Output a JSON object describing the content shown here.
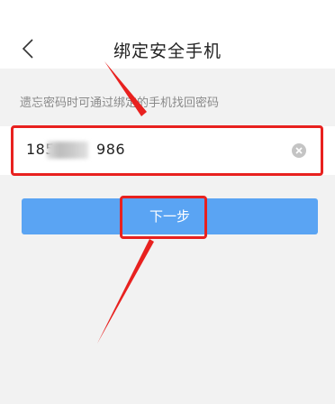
{
  "header": {
    "title": "绑定安全手机",
    "back_icon": "chevron-left-icon"
  },
  "hint": {
    "text": "遗忘密码时可通过绑定的手机找回密码"
  },
  "phone_input": {
    "prefix": "185",
    "suffix": "986",
    "clear_icon": "clear-circle-icon"
  },
  "next_button": {
    "label": "下一步"
  },
  "colors": {
    "accent": "#5aa4f3",
    "annotation": "#e8211f",
    "background": "#f2f2f2"
  }
}
